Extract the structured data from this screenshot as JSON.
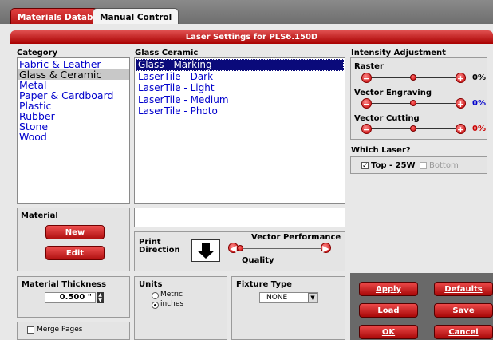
{
  "tabs": [
    {
      "label": "Materials Database"
    },
    {
      "label": "Manual Control"
    }
  ],
  "header": {
    "title": "Laser Settings for PLS6.150D"
  },
  "category": {
    "label": "Category",
    "items": [
      "Fabric & Leather",
      "Glass & Ceramic",
      "Metal",
      "Paper & Cardboard",
      "Plastic",
      "Rubber",
      "Stone",
      "Wood"
    ],
    "selected": "Glass & Ceramic"
  },
  "subcategory": {
    "label": "Glass  Ceramic",
    "items": [
      "Glass - Marking",
      "LaserTile - Dark",
      "LaserTile - Light",
      "LaserTile - Medium",
      "LaserTile - Photo"
    ],
    "selected": "Glass - Marking"
  },
  "intensity": {
    "label": "Intensity Adjustment",
    "raster": {
      "label": "Raster",
      "value": "0%",
      "color": "#000000"
    },
    "vector_engraving": {
      "label": "Vector Engraving",
      "value": "0%",
      "color": "#0000cc"
    },
    "vector_cutting": {
      "label": "Vector Cutting",
      "value": "0%",
      "color": "#cc0000"
    }
  },
  "which_laser": {
    "label": "Which Laser?",
    "top": {
      "label": "Top - 25W",
      "checked": true
    },
    "bottom": {
      "label": "Bottom",
      "checked": false
    }
  },
  "material": {
    "label": "Material",
    "new_label": "New",
    "edit_label": "Edit"
  },
  "print_direction": {
    "label_line1": "Print",
    "label_line2": "Direction"
  },
  "vector_performance": {
    "label": "Vector Performance",
    "quality_label": "Quality"
  },
  "thickness": {
    "label": "Material Thickness",
    "value": "0.500 \""
  },
  "units": {
    "label": "Units",
    "metric": "Metric",
    "inches": "inches",
    "selected": "inches"
  },
  "fixture": {
    "label": "Fixture Type",
    "value": "NONE"
  },
  "merge_pages": {
    "label": "Merge Pages",
    "checked": false
  },
  "actions": {
    "apply": "Apply",
    "defaults": "Defaults",
    "load": "Load",
    "save": "Save",
    "ok": "OK",
    "cancel": "Cancel"
  },
  "colors": {
    "accent": "#c01010",
    "selection": "#0a0a7a",
    "link_text": "#0000cc"
  }
}
